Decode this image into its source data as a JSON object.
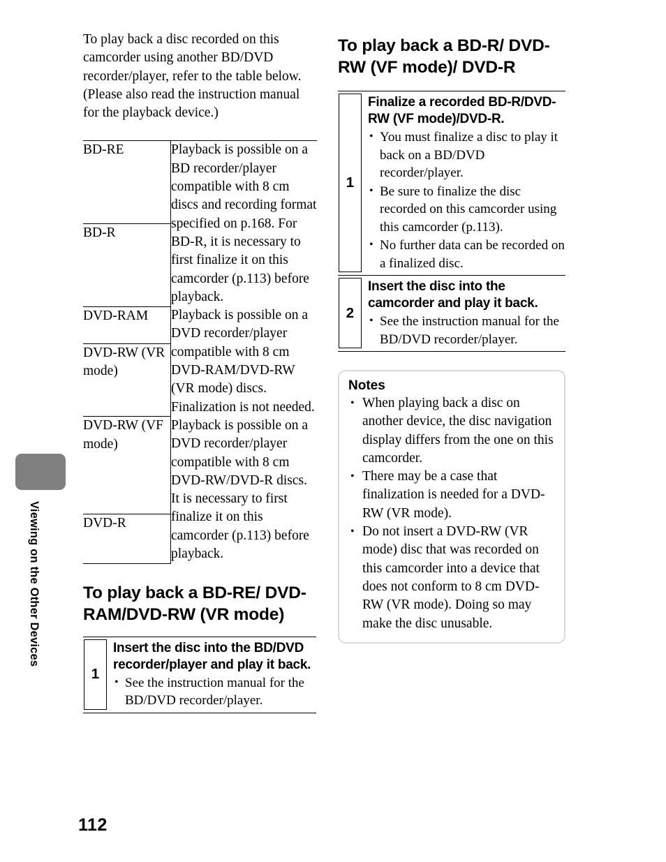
{
  "page": {
    "number": "112",
    "sidebar_label": "Viewing on the Other Devices",
    "tab_color": "#808080"
  },
  "left_column": {
    "intro": "To play back a disc recorded on this camcorder using another BD/DVD recorder/player, refer to the table below. (Please also read the instruction manual for the playback device.)",
    "table": {
      "groups": [
        {
          "discs": [
            "BD-RE",
            "BD-R"
          ],
          "description": "Playback is possible on a BD recorder/player compatible with 8 cm discs and recording format specified on p.168. For BD-R, it is necessary to first finalize it on this camcorder (p.113) before playback."
        },
        {
          "discs": [
            "DVD-RAM",
            "DVD-RW (VR mode)"
          ],
          "description": "Playback is possible on a DVD recorder/player compatible with 8 cm DVD-RAM/DVD-RW (VR mode) discs. Finalization is not needed."
        },
        {
          "discs": [
            "DVD-RW (VF mode)",
            "DVD-R"
          ],
          "description": "Playback is possible on a DVD recorder/player compatible with 8 cm DVD-RW/DVD-R discs. It is necessary to first finalize it on this camcorder (p.113) before playback."
        }
      ]
    },
    "heading": "To play back a BD-RE/ DVD-RAM/DVD-RW (VR mode)",
    "steps": [
      {
        "number": "1",
        "title": "Insert the disc into the BD/DVD recorder/player and play it back.",
        "bullets": [
          "See the instruction manual for the BD/DVD recorder/player."
        ]
      }
    ]
  },
  "right_column": {
    "heading": "To play back a BD-R/ DVD-RW (VF mode)/ DVD-R",
    "steps": [
      {
        "number": "1",
        "title": "Finalize a recorded BD-R/DVD-RW (VF mode)/DVD-R.",
        "bullets": [
          "You must finalize a disc to play it back on a BD/DVD recorder/player.",
          "Be sure to finalize the disc recorded on this camcorder using this camcorder (p.113).",
          "No further data can be recorded on a finalized disc."
        ]
      },
      {
        "number": "2",
        "title": "Insert the disc into the camcorder and play it back.",
        "bullets": [
          "See the instruction manual for the BD/DVD recorder/player."
        ]
      }
    ],
    "notes": {
      "title": "Notes",
      "items": [
        "When playing back a disc on another device, the disc navigation display differs from the one on this camcorder.",
        "There may be a case that finalization is needed for a DVD-RW (VR mode).",
        "Do not insert a DVD-RW (VR mode) disc that was recorded on this camcorder into a device that does not conform to 8 cm DVD-RW (VR mode). Doing so may make the disc unusable."
      ]
    }
  }
}
